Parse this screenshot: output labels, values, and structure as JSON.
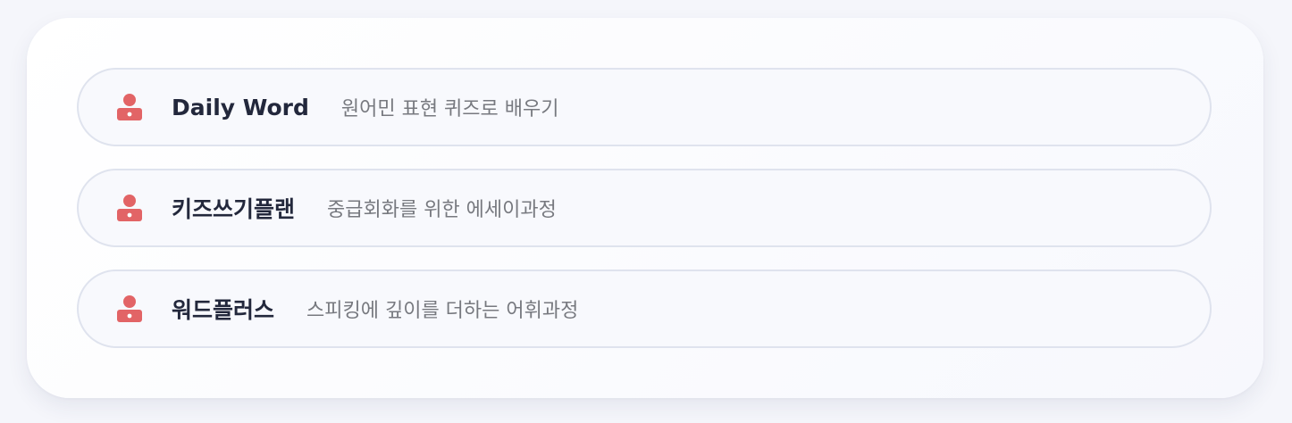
{
  "accent_color": "#e26466",
  "items": [
    {
      "icon": "user-badge-icon",
      "title": "Daily Word",
      "description": "원어민 표현 퀴즈로 배우기"
    },
    {
      "icon": "user-badge-icon",
      "title": "키즈쓰기플랜",
      "description": "중급회화를 위한 에세이과정"
    },
    {
      "icon": "user-badge-icon",
      "title": "워드플러스",
      "description": "스피킹에 깊이를 더하는 어휘과정"
    }
  ]
}
